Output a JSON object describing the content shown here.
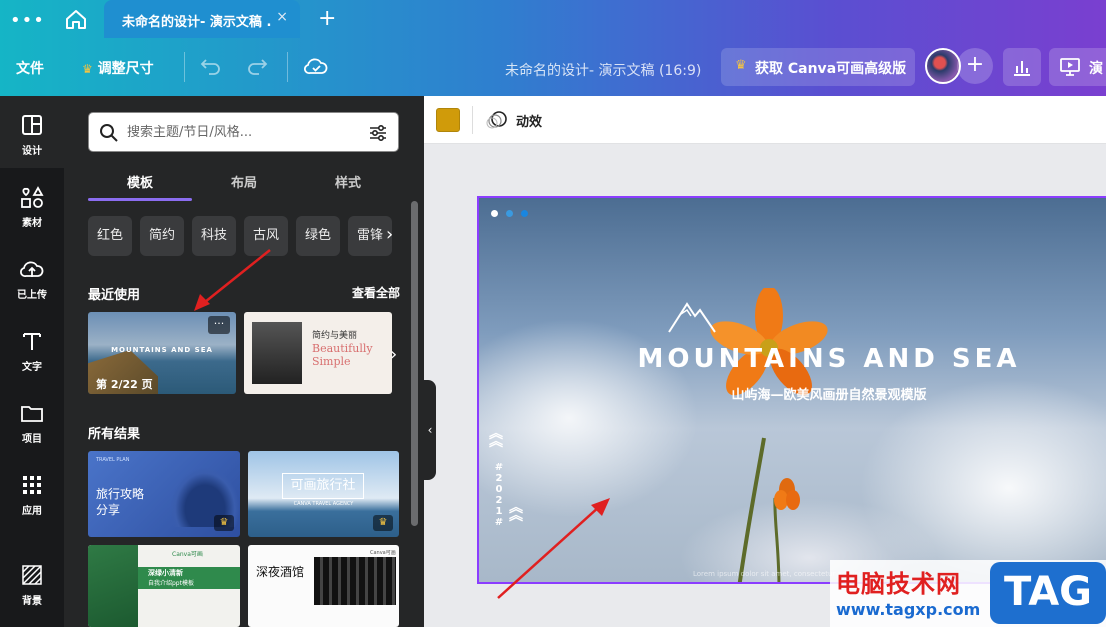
{
  "tabbar": {
    "tab_title": "未命名的设计- 演示文稿 ...",
    "close": "×",
    "new_tab": "+",
    "menu": "•••"
  },
  "toolbar": {
    "file": "文件",
    "resize": "调整尺寸",
    "doc_title": "未命名的设计- 演示文稿 (16:9)",
    "pro_label": "获取 Canva可画高级版",
    "present_label": "演"
  },
  "rail": [
    {
      "label": "设计",
      "icon": "layout-icon",
      "active": true
    },
    {
      "label": "素材",
      "icon": "elements-icon",
      "active": false
    },
    {
      "label": "已上传",
      "icon": "upload-icon",
      "active": false
    },
    {
      "label": "文字",
      "icon": "text-icon",
      "active": false
    },
    {
      "label": "项目",
      "icon": "folder-icon",
      "active": false
    },
    {
      "label": "应用",
      "icon": "apps-icon",
      "active": false
    },
    {
      "label": "背景",
      "icon": "background-icon",
      "active": false
    }
  ],
  "panel": {
    "search_placeholder": "搜索主题/节日/风格...",
    "tabs": [
      "模板",
      "布局",
      "样式"
    ],
    "chips": [
      "红色",
      "简约",
      "科技",
      "古风",
      "绿色",
      "雷锋"
    ],
    "recent_title": "最近使用",
    "see_all": "查看全部",
    "recent": [
      {
        "title": "MOUNTAINS AND SEA",
        "badge": "第 2/22 页",
        "more": "···"
      },
      {
        "title": "简约与美丽",
        "subtitle1": "Beautifully",
        "subtitle2": "Simple"
      }
    ],
    "all_title": "所有结果",
    "results": [
      {
        "title_line1": "旅行攻略",
        "title_line2": "分享",
        "small": "TRAVEL PLAN"
      },
      {
        "title": "可画旅行社",
        "small": "CANVA TRAVEL AGENCY"
      },
      {
        "title_line1": "深绿小清新",
        "title_line2": "自我介绍ppt模板",
        "brand": "Canva可画"
      },
      {
        "title": "深夜酒馆",
        "brand": "Canva可画"
      }
    ]
  },
  "context": {
    "animate": "动效",
    "swatch_color": "#d09b0a"
  },
  "slide": {
    "title": "MOUNTAINS AND SEA",
    "subtitle": "山屿海—欧美风画册自然景观模版",
    "vertical_year": "#2021#",
    "footer": "Lorem ipsum dolor sit amet, consectetur adipiscing"
  },
  "watermark": {
    "cn": "电脑技术网",
    "url": "www.tagxp.com",
    "tag": "TAG"
  },
  "colors": {
    "accent": "#8b3dff",
    "tab_underline": "#8b6df0",
    "crown": "#f5c542",
    "arrow": "#e02020"
  }
}
